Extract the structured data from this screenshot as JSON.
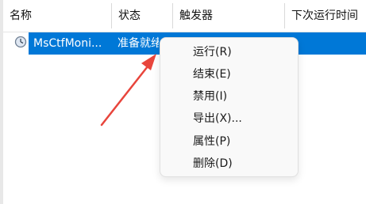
{
  "table": {
    "columns": [
      "名称",
      "状态",
      "触发器",
      "下次运行时间"
    ],
    "row": {
      "name": "MsCtfMoni...",
      "status": "准备就绪"
    }
  },
  "context_menu": {
    "items": [
      "运行(R)",
      "结束(E)",
      "禁用(I)",
      "导出(X)...",
      "属性(P)",
      "删除(D)"
    ]
  },
  "colors": {
    "selection": "#0078d7",
    "annotation_arrow": "#e8453c"
  },
  "icons": {
    "task": "clock-icon"
  }
}
